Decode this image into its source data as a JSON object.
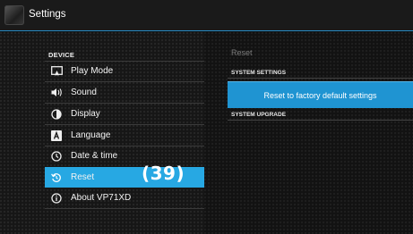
{
  "app": {
    "title": "Settings"
  },
  "sidebar": {
    "section": "DEVICE",
    "items": [
      {
        "label": "Play Mode",
        "icon": "play-mode-icon"
      },
      {
        "label": "Sound",
        "icon": "speaker-icon"
      },
      {
        "label": "Display",
        "icon": "brightness-icon"
      },
      {
        "label": "Language",
        "icon": "language-icon"
      },
      {
        "label": "Date & time",
        "icon": "clock-icon"
      },
      {
        "label": "Reset",
        "icon": "reset-icon"
      },
      {
        "label": "About VP71XD",
        "icon": "info-icon"
      }
    ],
    "selected": "Reset",
    "overlay_label": "(39)"
  },
  "main": {
    "title": "Reset",
    "system_settings_header": "SYSTEM SETTINGS",
    "factory_reset_label": "Reset to factory default settings",
    "system_upgrade_header": "SYSTEM UPGRADE"
  },
  "colors": {
    "accent": "#27a8e3",
    "button": "#1f94d2",
    "title_bar_line": "#2a8fc8"
  }
}
